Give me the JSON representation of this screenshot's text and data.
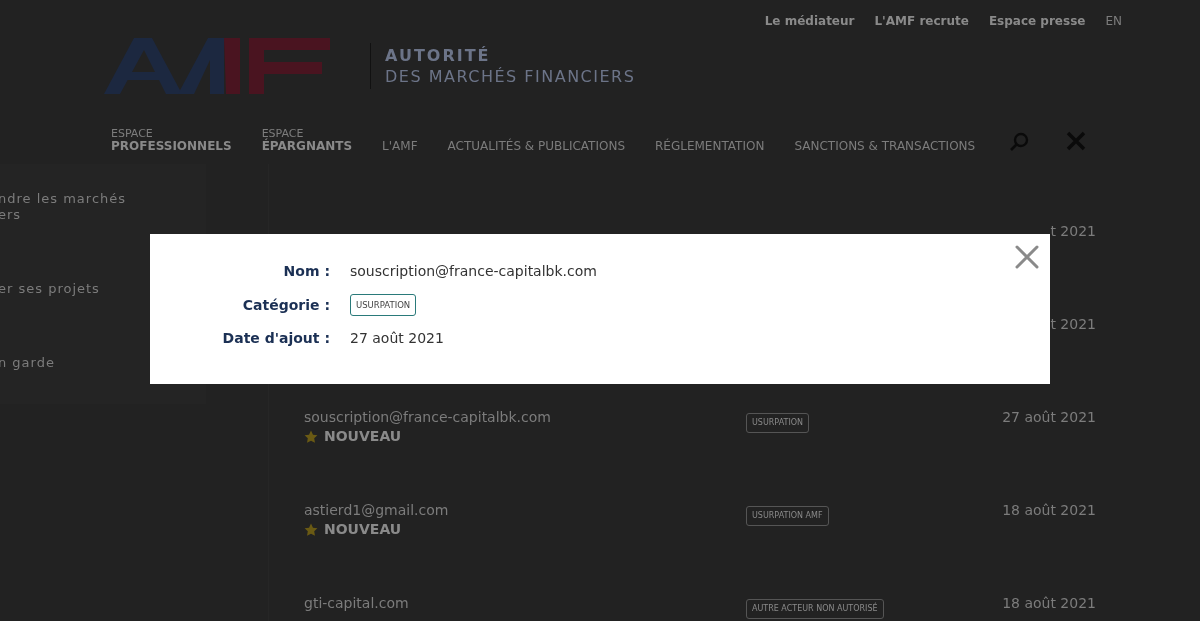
{
  "top_links": [
    "Le médiateur",
    "L'AMF recrute",
    "Espace presse"
  ],
  "language": "EN",
  "brand": {
    "line1": "AUTORITÉ",
    "line2": "DES MARCHÉS FINANCIERS"
  },
  "nav": [
    {
      "kind": "double",
      "small": "ESPACE",
      "label": "PROFESSIONNELS"
    },
    {
      "kind": "double",
      "small": "ESPACE",
      "label": "ÉPARGNANTS"
    },
    {
      "kind": "single",
      "label": "L'AMF"
    },
    {
      "kind": "single",
      "label": "ACTUALITÉS & PUBLICATIONS"
    },
    {
      "kind": "single",
      "label": "RÉGLEMENTATION"
    },
    {
      "kind": "single",
      "label": "SANCTIONS & TRANSACTIONS"
    }
  ],
  "sidebar": {
    "items": [
      [
        "ndre les marchés",
        "ers"
      ],
      [
        "er ses projets"
      ],
      [
        "n garde"
      ]
    ]
  },
  "list": {
    "rows": [
      {
        "date": "t 2021"
      },
      {
        "date": "t 2021"
      },
      {
        "name": "souscription@france-capitalbk.com",
        "new": true,
        "new_label": "NOUVEAU",
        "category": "USURPATION",
        "date": "27 août 2021"
      },
      {
        "name": "astierd1@gmail.com",
        "new": true,
        "new_label": "NOUVEAU",
        "category": "USURPATION AMF",
        "date": "18 août 2021"
      },
      {
        "name": "gti-capital.com",
        "new": false,
        "category": "AUTRE ACTEUR NON AUTORISÉ",
        "date": "18 août 2021"
      }
    ]
  },
  "modal": {
    "fields": [
      {
        "kind": "text",
        "label": "Nom :",
        "value": "souscription@france-capitalbk.com"
      },
      {
        "kind": "tag",
        "label": "Catégorie :",
        "value": "USURPATION"
      },
      {
        "kind": "text",
        "label": "Date d'ajout :",
        "value": "27 août 2021"
      }
    ]
  }
}
